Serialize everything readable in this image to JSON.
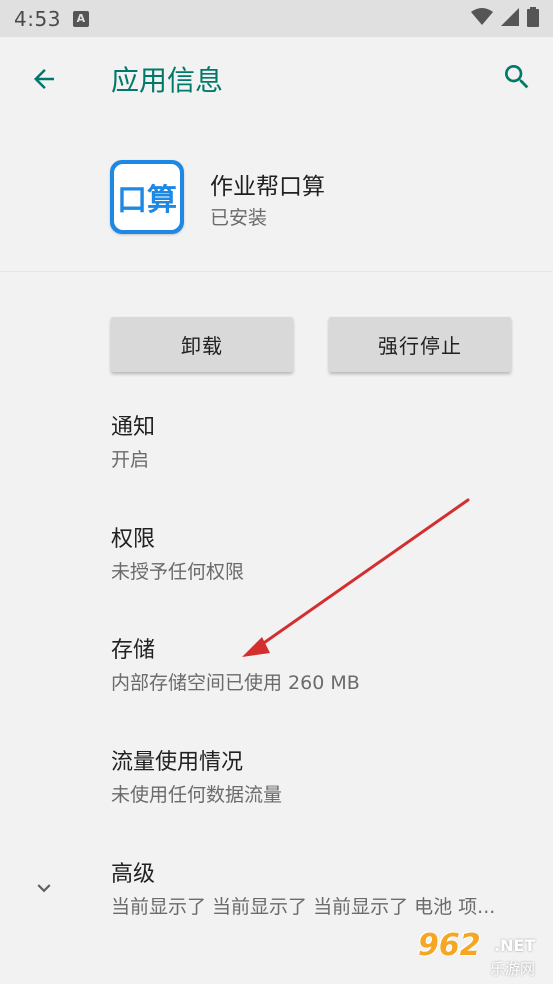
{
  "status_bar": {
    "time": "4:53",
    "notification_icon": "A"
  },
  "app_bar": {
    "title": "应用信息",
    "back_icon": "arrow-back-icon",
    "search_icon": "search-icon"
  },
  "app": {
    "name": "作业帮口算",
    "status": "已安装",
    "icon_glyph": "口算"
  },
  "buttons": {
    "uninstall": "卸载",
    "force_stop": "强行停止"
  },
  "settings": [
    {
      "title": "通知",
      "summary": "开启"
    },
    {
      "title": "权限",
      "summary": "未授予任何权限"
    },
    {
      "title": "存储",
      "summary": "内部存储空间已使用 260 MB"
    },
    {
      "title": "流量使用情况",
      "summary": "未使用任何数据流量"
    },
    {
      "title": "高级",
      "summary": "当前显示了 当前显示了 当前显示了 电池 项..."
    }
  ],
  "watermark": {
    "number": "962",
    "net": ".NET",
    "sub": "乐游网"
  },
  "colors": {
    "accent": "#00796b",
    "arrow": "#d32f2f",
    "app_icon": "#1e88e5"
  }
}
